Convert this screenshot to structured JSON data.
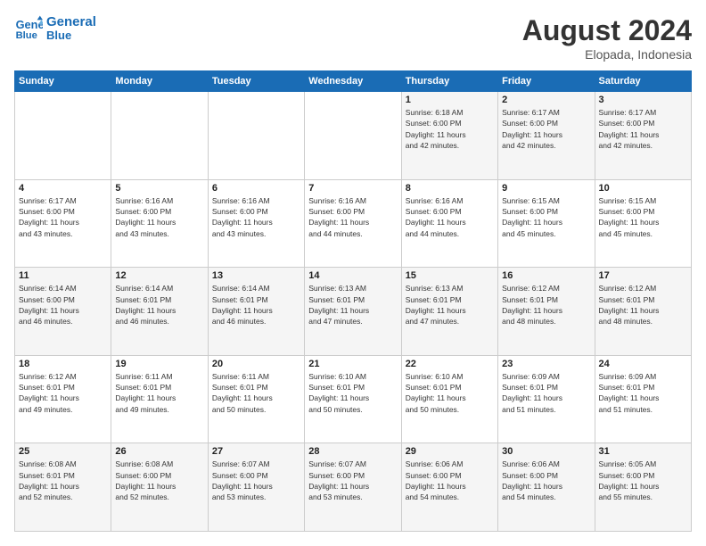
{
  "header": {
    "logo_line1": "General",
    "logo_line2": "Blue",
    "month_year": "August 2024",
    "location": "Elopada, Indonesia"
  },
  "days_of_week": [
    "Sunday",
    "Monday",
    "Tuesday",
    "Wednesday",
    "Thursday",
    "Friday",
    "Saturday"
  ],
  "weeks": [
    [
      {
        "day": "",
        "info": ""
      },
      {
        "day": "",
        "info": ""
      },
      {
        "day": "",
        "info": ""
      },
      {
        "day": "",
        "info": ""
      },
      {
        "day": "1",
        "info": "Sunrise: 6:18 AM\nSunset: 6:00 PM\nDaylight: 11 hours\nand 42 minutes."
      },
      {
        "day": "2",
        "info": "Sunrise: 6:17 AM\nSunset: 6:00 PM\nDaylight: 11 hours\nand 42 minutes."
      },
      {
        "day": "3",
        "info": "Sunrise: 6:17 AM\nSunset: 6:00 PM\nDaylight: 11 hours\nand 42 minutes."
      }
    ],
    [
      {
        "day": "4",
        "info": "Sunrise: 6:17 AM\nSunset: 6:00 PM\nDaylight: 11 hours\nand 43 minutes."
      },
      {
        "day": "5",
        "info": "Sunrise: 6:16 AM\nSunset: 6:00 PM\nDaylight: 11 hours\nand 43 minutes."
      },
      {
        "day": "6",
        "info": "Sunrise: 6:16 AM\nSunset: 6:00 PM\nDaylight: 11 hours\nand 43 minutes."
      },
      {
        "day": "7",
        "info": "Sunrise: 6:16 AM\nSunset: 6:00 PM\nDaylight: 11 hours\nand 44 minutes."
      },
      {
        "day": "8",
        "info": "Sunrise: 6:16 AM\nSunset: 6:00 PM\nDaylight: 11 hours\nand 44 minutes."
      },
      {
        "day": "9",
        "info": "Sunrise: 6:15 AM\nSunset: 6:00 PM\nDaylight: 11 hours\nand 45 minutes."
      },
      {
        "day": "10",
        "info": "Sunrise: 6:15 AM\nSunset: 6:00 PM\nDaylight: 11 hours\nand 45 minutes."
      }
    ],
    [
      {
        "day": "11",
        "info": "Sunrise: 6:14 AM\nSunset: 6:00 PM\nDaylight: 11 hours\nand 46 minutes."
      },
      {
        "day": "12",
        "info": "Sunrise: 6:14 AM\nSunset: 6:01 PM\nDaylight: 11 hours\nand 46 minutes."
      },
      {
        "day": "13",
        "info": "Sunrise: 6:14 AM\nSunset: 6:01 PM\nDaylight: 11 hours\nand 46 minutes."
      },
      {
        "day": "14",
        "info": "Sunrise: 6:13 AM\nSunset: 6:01 PM\nDaylight: 11 hours\nand 47 minutes."
      },
      {
        "day": "15",
        "info": "Sunrise: 6:13 AM\nSunset: 6:01 PM\nDaylight: 11 hours\nand 47 minutes."
      },
      {
        "day": "16",
        "info": "Sunrise: 6:12 AM\nSunset: 6:01 PM\nDaylight: 11 hours\nand 48 minutes."
      },
      {
        "day": "17",
        "info": "Sunrise: 6:12 AM\nSunset: 6:01 PM\nDaylight: 11 hours\nand 48 minutes."
      }
    ],
    [
      {
        "day": "18",
        "info": "Sunrise: 6:12 AM\nSunset: 6:01 PM\nDaylight: 11 hours\nand 49 minutes."
      },
      {
        "day": "19",
        "info": "Sunrise: 6:11 AM\nSunset: 6:01 PM\nDaylight: 11 hours\nand 49 minutes."
      },
      {
        "day": "20",
        "info": "Sunrise: 6:11 AM\nSunset: 6:01 PM\nDaylight: 11 hours\nand 50 minutes."
      },
      {
        "day": "21",
        "info": "Sunrise: 6:10 AM\nSunset: 6:01 PM\nDaylight: 11 hours\nand 50 minutes."
      },
      {
        "day": "22",
        "info": "Sunrise: 6:10 AM\nSunset: 6:01 PM\nDaylight: 11 hours\nand 50 minutes."
      },
      {
        "day": "23",
        "info": "Sunrise: 6:09 AM\nSunset: 6:01 PM\nDaylight: 11 hours\nand 51 minutes."
      },
      {
        "day": "24",
        "info": "Sunrise: 6:09 AM\nSunset: 6:01 PM\nDaylight: 11 hours\nand 51 minutes."
      }
    ],
    [
      {
        "day": "25",
        "info": "Sunrise: 6:08 AM\nSunset: 6:01 PM\nDaylight: 11 hours\nand 52 minutes."
      },
      {
        "day": "26",
        "info": "Sunrise: 6:08 AM\nSunset: 6:00 PM\nDaylight: 11 hours\nand 52 minutes."
      },
      {
        "day": "27",
        "info": "Sunrise: 6:07 AM\nSunset: 6:00 PM\nDaylight: 11 hours\nand 53 minutes."
      },
      {
        "day": "28",
        "info": "Sunrise: 6:07 AM\nSunset: 6:00 PM\nDaylight: 11 hours\nand 53 minutes."
      },
      {
        "day": "29",
        "info": "Sunrise: 6:06 AM\nSunset: 6:00 PM\nDaylight: 11 hours\nand 54 minutes."
      },
      {
        "day": "30",
        "info": "Sunrise: 6:06 AM\nSunset: 6:00 PM\nDaylight: 11 hours\nand 54 minutes."
      },
      {
        "day": "31",
        "info": "Sunrise: 6:05 AM\nSunset: 6:00 PM\nDaylight: 11 hours\nand 55 minutes."
      }
    ]
  ]
}
